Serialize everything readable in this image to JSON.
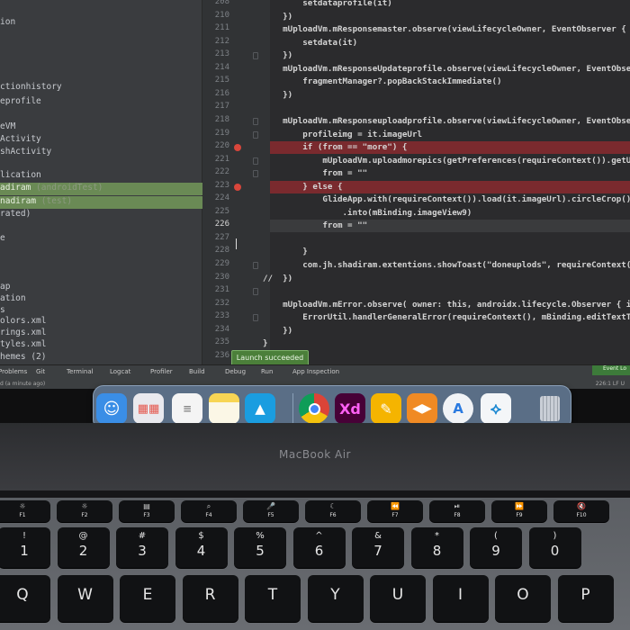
{
  "project_tree": {
    "items": [
      {
        "label": "ion"
      },
      {
        "label": "ctionhistory"
      },
      {
        "label": "eprofile"
      },
      {
        "label": "eVM"
      },
      {
        "label": "Activity"
      },
      {
        "label": "shActivity"
      },
      {
        "label": "lication"
      },
      {
        "label": "adiram",
        "note": "(androidTest)"
      },
      {
        "label": "nadiram",
        "note": "(test)"
      },
      {
        "label": "rated)"
      },
      {
        "label": "e"
      },
      {
        "label": "ap"
      },
      {
        "label": "ation"
      },
      {
        "label": "s"
      },
      {
        "label": "olors.xml"
      },
      {
        "label": "rings.xml"
      },
      {
        "label": "tyles.xml"
      },
      {
        "label": "hemes (2)"
      }
    ]
  },
  "editor": {
    "line_numbers": [
      "208",
      "210",
      "211",
      "212",
      "213",
      "214",
      "215",
      "216",
      "217",
      "218",
      "219",
      "220",
      "221",
      "222",
      "223",
      "224",
      "225",
      "226",
      "227",
      "228",
      "229",
      "230",
      "231",
      "232",
      "233",
      "234",
      "235",
      "236"
    ],
    "current_line": "226",
    "breakpoint_lines": [
      "220",
      "223"
    ],
    "lines": [
      "        setdataprofile(it)",
      "    })",
      "    mUploadVm.mResponsemaster.observe(viewLifecycleOwner, EventObserver {",
      "        setdata(it)",
      "    })",
      "    mUploadVm.mResponseUpdateprofile.observe(viewLifecycleOwner, EventObserver",
      "        fragmentManager?.popBackStackImmediate()",
      "    })",
      "",
      "    mUploadVm.mResponseuploadprofile.observe(viewLifecycleOwner, EventObserver {",
      "        profileimg = it.imageUrl",
      "        if (from == \"more\") {",
      "            mUploadVm.uploadmorepics(getPreferences(requireContext()).getUserId,",
      "            from = \"\"",
      "        } else {",
      "            GlideApp.with(requireContext()).load(it.imageUrl).circleCrop()",
      "                .into(mBinding.imageView9)",
      "            from = \"\"",
      "",
      "        }",
      "        com.jh.shadiram.extentions.showToast(\"doneuplods\", requireContext())",
      "//  })",
      "",
      "    mUploadVm.mError.observe( owner: this, androidx.lifecycle.Observer { it: Throwable!",
      "        ErrorUtil.handlerGeneralError(requireContext(), mBinding.editTextTextPersonN",
      "    })",
      "}",
      ""
    ]
  },
  "tool_window_bar": {
    "tabs": [
      "Problems",
      "Git",
      "Terminal",
      "Logcat",
      "Profiler",
      "Build",
      "Debug",
      "Run",
      "App Inspection"
    ],
    "event_log": "Event Lo",
    "status_left": "d (a minute ago)",
    "status_right": "226:1  LF  U"
  },
  "toast": {
    "text": "Launch succeeded"
  },
  "dock": {
    "apps": [
      {
        "name": "Finder",
        "icon": "finder-icon",
        "color": "#3a8ee6"
      },
      {
        "name": "Launchpad",
        "icon": "launchpad-icon",
        "color": "#e9e9ee"
      },
      {
        "name": "Reminders",
        "icon": "reminders-icon",
        "color": "#f4f4f4"
      },
      {
        "name": "Notes",
        "icon": "notes-icon",
        "color": "#f7d554"
      },
      {
        "name": "Keynote",
        "icon": "keynote-icon",
        "color": "#1a9de0"
      },
      {
        "name": "Chrome",
        "icon": "chrome-icon",
        "color": "#ffffff"
      },
      {
        "name": "Adobe XD",
        "icon": "xd-icon",
        "color": "#470137",
        "label": "Xd"
      },
      {
        "name": "Sketchbook",
        "icon": "pen-icon",
        "color": "#f5b400"
      },
      {
        "name": "Transfer",
        "icon": "transfer-icon",
        "color": "#f08a24"
      },
      {
        "name": "Xcode Simulator",
        "icon": "simulator-icon",
        "color": "#f1f3f6"
      },
      {
        "name": "VS Code",
        "icon": "vscode-icon",
        "color": "#1f8ad2"
      },
      {
        "name": "Trash",
        "icon": "trash-icon",
        "color": "#c9ced6"
      }
    ]
  },
  "laptop": {
    "brand": "MacBook Air"
  },
  "keyboard": {
    "fn_row": [
      {
        "label": "F1",
        "icon": "brightness-down-icon"
      },
      {
        "label": "F2",
        "icon": "brightness-up-icon"
      },
      {
        "label": "F3",
        "icon": "mission-control-icon"
      },
      {
        "label": "F4",
        "icon": "search-icon"
      },
      {
        "label": "F5",
        "icon": "mic-icon"
      },
      {
        "label": "F6",
        "icon": "moon-icon"
      },
      {
        "label": "F7",
        "icon": "rewind-icon"
      },
      {
        "label": "F8",
        "icon": "play-pause-icon"
      },
      {
        "label": "F9",
        "icon": "fast-forward-icon"
      },
      {
        "label": "F10",
        "icon": "mute-icon"
      }
    ],
    "number_row": [
      {
        "top": "!",
        "bottom": "1"
      },
      {
        "top": "@",
        "bottom": "2"
      },
      {
        "top": "#",
        "bottom": "3"
      },
      {
        "top": "$",
        "bottom": "4"
      },
      {
        "top": "%",
        "bottom": "5"
      },
      {
        "top": "^",
        "bottom": "6"
      },
      {
        "top": "&",
        "bottom": "7"
      },
      {
        "top": "*",
        "bottom": "8"
      },
      {
        "top": "(",
        "bottom": "9"
      },
      {
        "top": ")",
        "bottom": "0"
      }
    ],
    "letter_row": [
      "Q",
      "W",
      "E",
      "R",
      "T",
      "Y",
      "U",
      "I",
      "O",
      "P"
    ]
  }
}
